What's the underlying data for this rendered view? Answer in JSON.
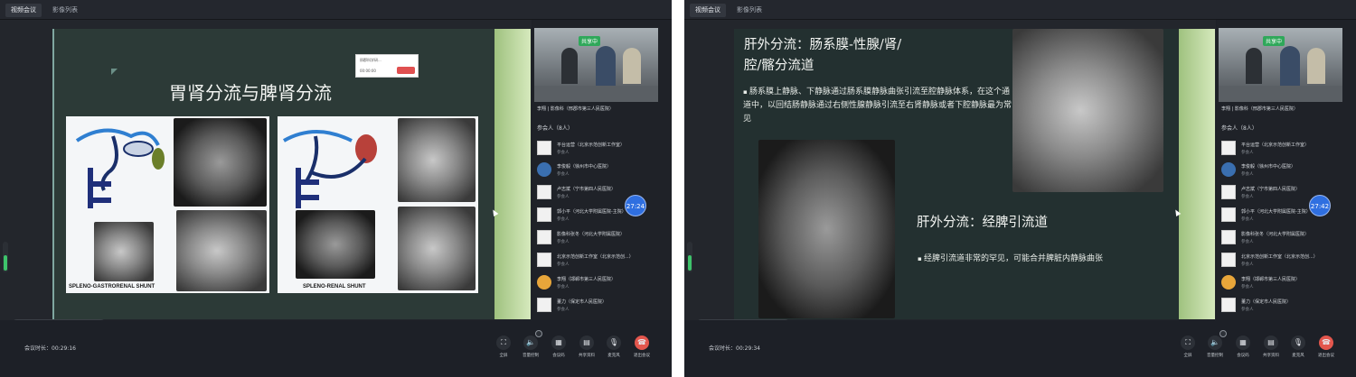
{
  "windows": [
    {
      "tabs": [
        "视频会议",
        "影像列表"
      ],
      "slide": {
        "title": "胃肾分流与脾肾分流",
        "labels": [
          "SPLENO-GASTRORENAL SHUNT",
          "SPLENO-RENAL SHUNT"
        ]
      },
      "timer": "27:24",
      "duration_label": "会议时长：",
      "duration_value": "00:29:16"
    },
    {
      "tabs": [
        "视频会议",
        "影像列表"
      ],
      "slide": {
        "title1": "肝外分流：肠系膜-性腺/肾/",
        "title1b": "腔/髂分流道",
        "bullet1": "肠系膜上静脉、下静脉通过肠系膜静脉曲张引流至腔静脉体系，在这个通道中，以回结肠静脉通过右侧性腺静脉引流至右肾静脉或者下腔静脉最为常见",
        "title2": "肝外分流：经脾引流道",
        "bullet2": "经脾引流道非常的罕见，可能合并脾脏内静脉曲张"
      },
      "timer": "27:42",
      "duration_label": "会议时长：",
      "duration_value": "00:29:34"
    }
  ],
  "sidebar": {
    "share_badge": "共享中",
    "camera_caption": "李翔 | 影像科（邢郡市第三人民医院）",
    "participants_header": "参会人（8人）",
    "participants": [
      {
        "name": "平台运营（北京示范创新工作室）",
        "role": "参会人",
        "avatar": "blank"
      },
      {
        "name": "李俊毅（徐州市中心医院）",
        "role": "参会人",
        "avatar": "face"
      },
      {
        "name": "卢志斌（宁市第四人民医院）",
        "role": "参会人",
        "avatar": "blank"
      },
      {
        "name": "郭小平（河北大学附属医院-主院）",
        "role": "参会人",
        "avatar": "blank"
      },
      {
        "name": "影像科张冬（河北大学附属医院）",
        "role": "参会人",
        "avatar": "blank"
      },
      {
        "name": "北京示范创新工作室（北京示范创...）",
        "role": "参会人",
        "avatar": "blank"
      },
      {
        "name": "李翔（邯郸市第三人民医院）",
        "role": "参会人",
        "avatar": "kid"
      },
      {
        "name": "董力（保定市人民医院）",
        "role": "参会人",
        "avatar": "blank"
      }
    ]
  },
  "controls": [
    {
      "label": "全屏",
      "icon": "⛶"
    },
    {
      "label": "音量控制",
      "icon": "🔈"
    },
    {
      "label": "会议码",
      "icon": "▦"
    },
    {
      "label": "共享资料",
      "icon": "▤"
    },
    {
      "label": "麦克风",
      "icon": "🎙"
    },
    {
      "label": "退出会议",
      "icon": "☎"
    }
  ],
  "popup": {
    "line1": "邢郡科学研...",
    "line2": "00:00:00"
  }
}
